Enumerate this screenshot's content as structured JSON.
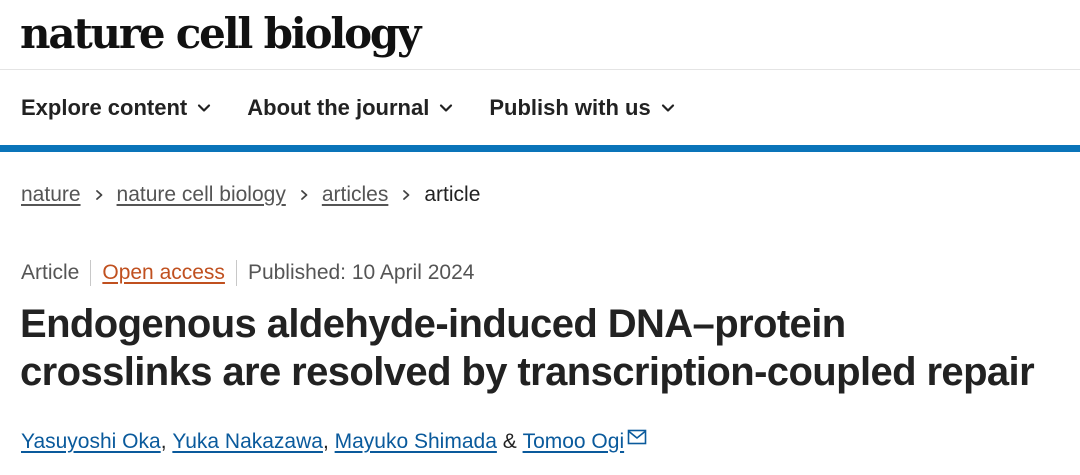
{
  "site": {
    "brand": "nature cell biology"
  },
  "nav": {
    "items": [
      {
        "label": "Explore content",
        "icon": "chevron-down-icon"
      },
      {
        "label": "About the journal",
        "icon": "chevron-down-icon"
      },
      {
        "label": "Publish with us",
        "icon": "chevron-down-icon"
      }
    ]
  },
  "breadcrumb": {
    "items": [
      "nature",
      "nature cell biology",
      "articles"
    ],
    "current": "article"
  },
  "article": {
    "type": "Article",
    "access": "Open access",
    "published": "Published: 10 April 2024",
    "title_line1": "Endogenous aldehyde-induced DNA–protein",
    "title_line2": "crosslinks are resolved by transcription-coupled repair",
    "authors": [
      "Yasuyoshi Oka",
      "Yuka Nakazawa",
      "Mayuko Shimada",
      "Tomoo Ogi"
    ],
    "author_sep": ", ",
    "author_last_sep": " & ",
    "corresponding_icon": "mail-icon"
  },
  "colors": {
    "accent_bar": "#0a74b9",
    "open_access": "#c0501f",
    "author_link": "#0a5a9c",
    "text": "#222222"
  }
}
